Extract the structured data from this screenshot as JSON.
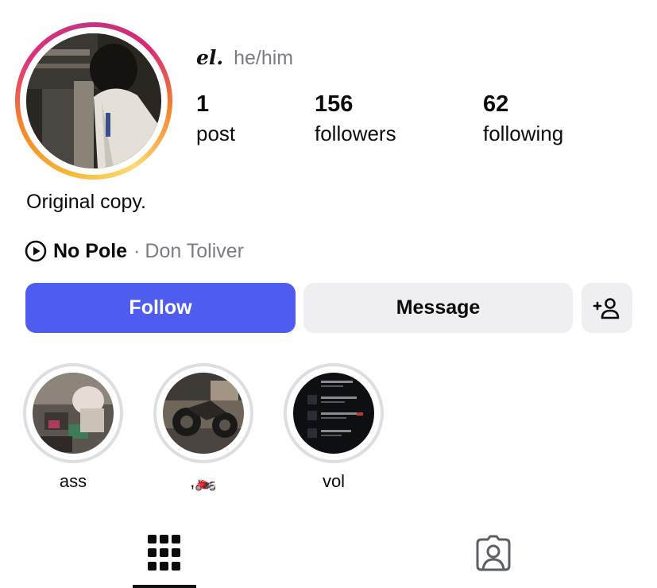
{
  "profile": {
    "display_name": "el.",
    "pronouns": "he/him",
    "avatar_desc": "profile-photo",
    "bio": "Original copy."
  },
  "stats": [
    {
      "value": "1",
      "label": "post"
    },
    {
      "value": "156",
      "label": "followers"
    },
    {
      "value": "62",
      "label": "following"
    }
  ],
  "music": {
    "icon": "play-circle-icon",
    "song": "No Pole",
    "separator": "·",
    "artist": "Don Toliver"
  },
  "actions": {
    "follow_label": "Follow",
    "message_label": "Message",
    "suggest_icon": "add-person-icon"
  },
  "highlights": [
    {
      "label": "ass"
    },
    {
      "label": ",🏍️"
    },
    {
      "label": "vol"
    }
  ],
  "tabs": [
    {
      "icon": "grid-icon",
      "selected": true
    },
    {
      "icon": "tagged-person-icon",
      "selected": false
    }
  ],
  "colors": {
    "follow_button": "#4e5cf0",
    "secondary_button": "#efeff2",
    "muted_text": "#7a7d83",
    "highlight_ring": "#dddee2"
  }
}
